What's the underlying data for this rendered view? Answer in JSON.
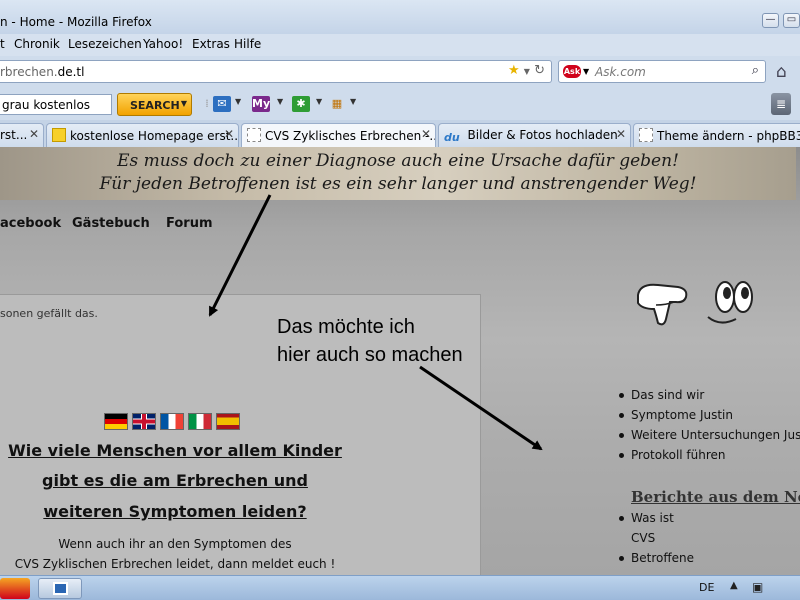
{
  "window": {
    "title": "n - Home - Mozilla Firefox",
    "buttons": {
      "minimize": "—",
      "restore": "▭",
      "close": "✕"
    }
  },
  "menu": {
    "items": [
      "t",
      "Chronik",
      "Lesezeichen",
      "Yahoo!",
      "Extras",
      "Hilfe"
    ]
  },
  "navbar": {
    "url_prefix": "rbrechen.",
    "url_domain": "de.tl",
    "ask_placeholder": "Ask.com",
    "ask_logo": "Ask"
  },
  "toolbar": {
    "search_value": "grau kostenlos",
    "search_button": "SEARCH",
    "mail_icon": "✉",
    "my_icon": "My",
    "asterisk_icon": "✱",
    "map_icon": "▦"
  },
  "tabs": [
    {
      "label": "rst...",
      "active": false
    },
    {
      "label": "kostenlose Homepage erst...",
      "active": false
    },
    {
      "label": "CVS Zyklisches Erbrechen -...",
      "active": true
    },
    {
      "label": "Bilder & Fotos hochladen",
      "active": false,
      "fav": "du"
    },
    {
      "label": "Theme ändern - phpBB3",
      "active": false
    }
  ],
  "page": {
    "banner": [
      "Es muss doch zu einer Diagnose auch eine Ursache dafür geben!",
      "Für jeden Betroffenen ist es ein sehr langer und anstrengender Weg!"
    ],
    "nav": [
      "acebook",
      "Gästebuch",
      "Forum"
    ],
    "fb_likes": "sonen gefällt das.",
    "heading": [
      "Wie viele  Menschen vor allem Kinder",
      "gibt es die am Erbrechen und",
      "weiteren Symptomen leiden?"
    ],
    "body": [
      "Wenn auch ihr an den Symptomen des",
      "CVS Zyklischen Erbrechen leidet, dann meldet euch !"
    ],
    "annotation": [
      "Das möchte ich",
      "hier auch so machen"
    ],
    "sidebar_links": [
      "Das sind wir",
      "Symptome Justin",
      "Weitere Untersuchungen Justin",
      "Protokoll führen"
    ],
    "sidebar_heading": "Berichte aus dem Netz",
    "sidebar_links2": [
      {
        "label": "Was ist",
        "bullet": true
      },
      {
        "label": "CVS",
        "bullet": false
      },
      {
        "label": "Betroffene",
        "bullet": true
      }
    ]
  },
  "taskbar": {
    "language": "DE"
  },
  "colors": {
    "search_button": "#f2a200",
    "ask_logo": "#d0021b",
    "page_bg": "#b5b5b5"
  }
}
